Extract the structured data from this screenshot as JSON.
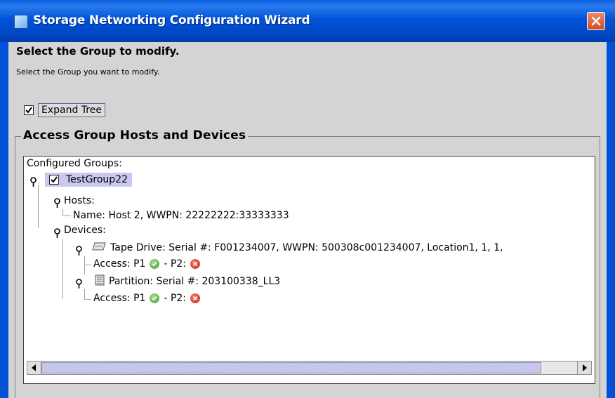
{
  "window": {
    "title": "Storage Networking Configuration Wizard",
    "title_bar_color": "#0050d8"
  },
  "page": {
    "heading": "Select the Group to modify.",
    "instruction": "Select the Group you want to modify."
  },
  "expand_tree": {
    "label": "Expand Tree",
    "checked": true
  },
  "group_box": {
    "title": "Access Group Hosts and Devices"
  },
  "tree": {
    "root_label": "Configured Groups:",
    "group": {
      "label": "TestGroup22",
      "checked": true,
      "selected": true
    },
    "hosts": {
      "label": "Hosts:",
      "items": [
        "Name: Host 2, WWPN: 22222222:33333333"
      ]
    },
    "devices": {
      "label": "Devices:",
      "items": [
        {
          "label": "Tape Drive: Serial #: F001234007, WWPN: 500308c001234007, Location1, 1, 1,",
          "icon": "tape-drive-icon",
          "access_prefix": "Access: P1",
          "p1_status": "ok",
          "p2_label": "- P2:",
          "p2_status": "error"
        },
        {
          "label": "Partition: Serial #: 203100338_LL3",
          "icon": "partition-icon",
          "access_prefix": "Access: P1",
          "p1_status": "ok",
          "p2_label": "- P2:",
          "p2_status": "error"
        }
      ]
    }
  },
  "colors": {
    "selection": "#c8c8f0",
    "ok": "#3f9a2a",
    "error": "#cf2110",
    "dialog_bg": "#d4d4d4"
  }
}
